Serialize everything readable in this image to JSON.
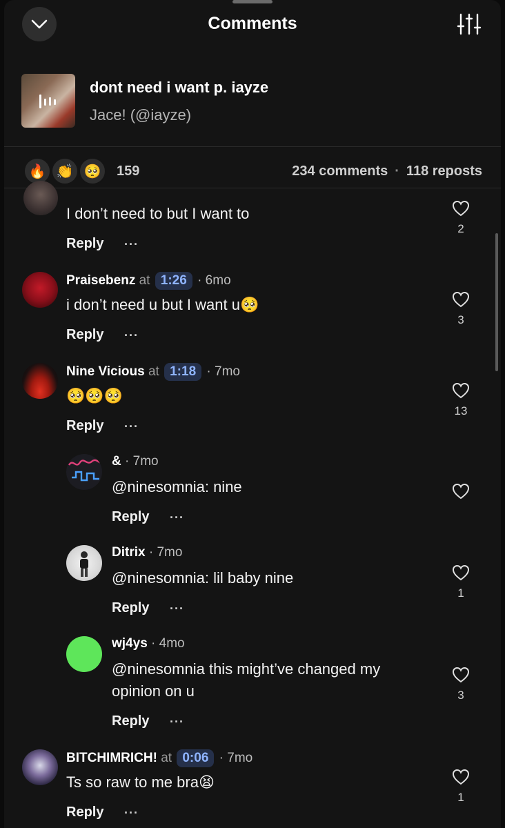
{
  "header": {
    "title": "Comments",
    "collapse_icon": "chevron-down-icon",
    "filter_icon": "sliders-icon"
  },
  "track": {
    "title": "dont need i want p. iayze",
    "artist": "Jace! (@iayze)"
  },
  "stats": {
    "reactions": [
      "🔥",
      "👏",
      "🥺"
    ],
    "reaction_count": "159",
    "comments": "234 comments",
    "separator": "·",
    "reposts": "118 reposts"
  },
  "comments": [
    {
      "text": "I don’t need to but I want to",
      "reply_label": "Reply",
      "more": "···",
      "likes": "2"
    },
    {
      "name": "Praisebenz",
      "at": "at",
      "timestamp": "1:26",
      "age": "· 6mo",
      "text": "i don’t need u but I want u🥺",
      "reply_label": "Reply",
      "more": "···",
      "likes": "3"
    },
    {
      "name": "Nine Vicious",
      "at": "at",
      "timestamp": "1:18",
      "age": "· 7mo",
      "text": "🥺🥺🥺",
      "reply_label": "Reply",
      "more": "···",
      "likes": "13"
    },
    {
      "name": "&",
      "age": "· 7mo",
      "text": "@ninesomnia: nine",
      "reply_label": "Reply",
      "more": "···",
      "likes": ""
    },
    {
      "name": "Ditrix",
      "age": "· 7mo",
      "text": "@ninesomnia: lil baby nine",
      "reply_label": "Reply",
      "more": "···",
      "likes": "1"
    },
    {
      "name": "wj4ys",
      "age": "· 4mo",
      "text_line1": "@ninesomnia this might’ve changed my",
      "text_line2": "opinion on u",
      "reply_label": "Reply",
      "more": "···",
      "likes": "3"
    },
    {
      "name": "BITCHIMRICH!",
      "at": "at",
      "timestamp": "0:06",
      "age": "· 7mo",
      "text": "Ts so raw to me bra😫",
      "reply_label": "Reply",
      "more": "···",
      "likes": "1"
    }
  ],
  "colors": {
    "background": "#141414",
    "timestamp_chip": "#25304a",
    "timestamp_text": "#8fb4ff",
    "green_avatar": "#5ee65a"
  }
}
